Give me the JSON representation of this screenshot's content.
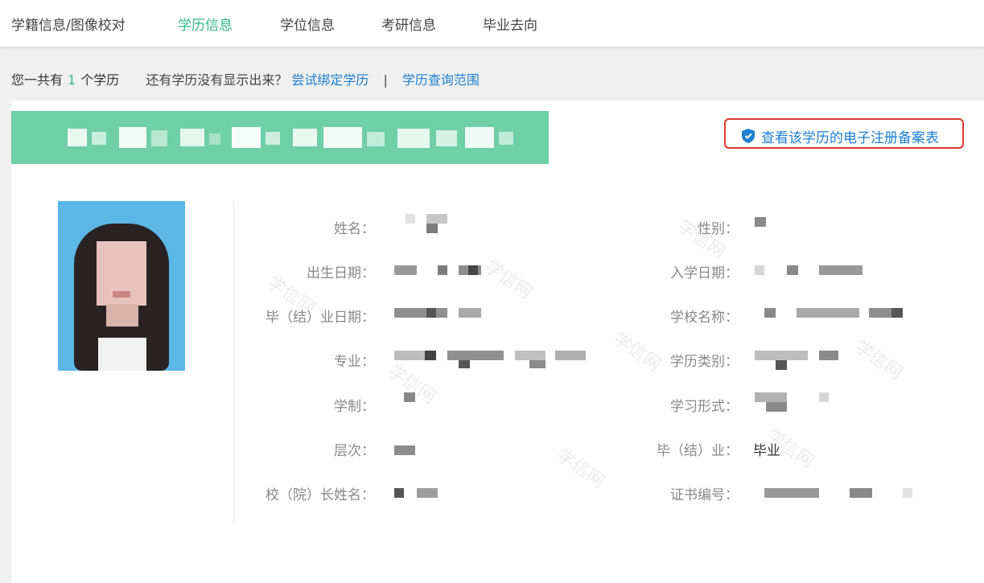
{
  "nav": {
    "tabs": [
      {
        "label": "学籍信息/图像校对",
        "active": false
      },
      {
        "label": "学历信息",
        "active": true
      },
      {
        "label": "学位信息",
        "active": false
      },
      {
        "label": "考研信息",
        "active": false
      },
      {
        "label": "毕业去向",
        "active": false
      }
    ],
    "active_color": "#2fb88a"
  },
  "summary": {
    "prefix": "您一共有",
    "count": "1",
    "suffix": "个学历",
    "question": "还有学历没有显示出来？",
    "bind_link": "尝试绑定学历",
    "separator": "|",
    "scope_link": "学历查询范围"
  },
  "registration_link": {
    "icon": "shield-check-icon",
    "label": "查看该学历的电子注册备案表",
    "highlight_color": "#e0372f"
  },
  "details": {
    "left": [
      {
        "label": "姓名："
      },
      {
        "label": "出生日期："
      },
      {
        "label": "毕（结）业日期："
      },
      {
        "label": "专业："
      },
      {
        "label": "学制："
      },
      {
        "label": "层次："
      },
      {
        "label": "校（院）长姓名："
      }
    ],
    "right": [
      {
        "label": "性别："
      },
      {
        "label": "入学日期："
      },
      {
        "label": "学校名称："
      },
      {
        "label": "学历类别："
      },
      {
        "label": "学习形式："
      },
      {
        "label": "毕（结）业：",
        "value": "毕业"
      },
      {
        "label": "证书编号："
      }
    ]
  },
  "watermark": "学信网"
}
